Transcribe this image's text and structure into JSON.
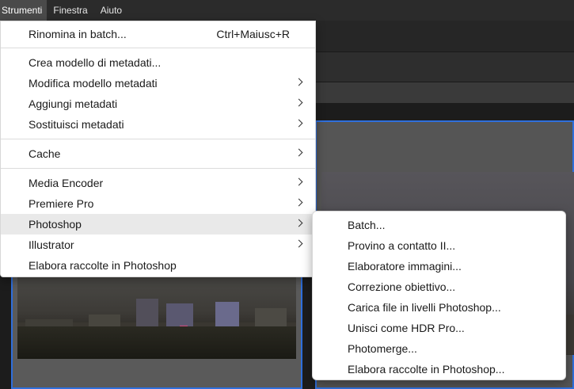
{
  "menubar": {
    "items": [
      {
        "label": "Strumenti",
        "active": true
      },
      {
        "label": "Finestra",
        "active": false
      },
      {
        "label": "Aiuto",
        "active": false
      }
    ]
  },
  "tools_menu": {
    "rename_batch": {
      "label": "Rinomina in batch...",
      "shortcut": "Ctrl+Maiusc+R"
    },
    "create_metadata_template": {
      "label": "Crea modello di metadati..."
    },
    "edit_metadata_template": {
      "label": "Modifica modello metadati"
    },
    "append_metadata": {
      "label": "Aggiungi metadati"
    },
    "replace_metadata": {
      "label": "Sostituisci metadati"
    },
    "cache": {
      "label": "Cache"
    },
    "media_encoder": {
      "label": "Media Encoder"
    },
    "premiere_pro": {
      "label": "Premiere Pro"
    },
    "photoshop": {
      "label": "Photoshop",
      "highlighted": true
    },
    "illustrator": {
      "label": "Illustrator"
    },
    "process_collections": {
      "label": "Elabora raccolte in Photoshop"
    }
  },
  "photoshop_submenu": {
    "items": [
      {
        "label": "Batch..."
      },
      {
        "label": "Provino a contatto II..."
      },
      {
        "label": "Elaboratore immagini..."
      },
      {
        "label": "Correzione obiettivo..."
      },
      {
        "label": "Carica file in livelli Photoshop..."
      },
      {
        "label": "Unisci come HDR Pro..."
      },
      {
        "label": "Photomerge..."
      },
      {
        "label": "Elabora raccolte in Photoshop..."
      }
    ]
  },
  "colors": {
    "selection_border": "#2f6fdc",
    "menu_background": "#ffffff",
    "menu_hover": "#e9e9e9",
    "app_background": "#1f1f1f"
  }
}
